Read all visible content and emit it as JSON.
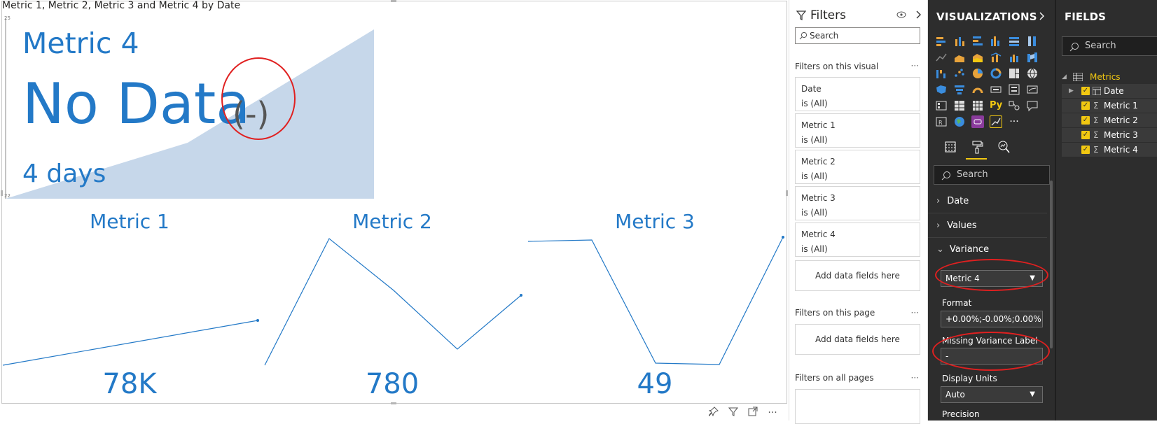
{
  "visual": {
    "title": "Metric 1, Metric 2, Metric 3 and Metric 4 by Date",
    "axis_top": "25",
    "axis_bottom": "22",
    "kpi_label": "Metric 4",
    "kpi_value": "No Data",
    "kpi_variance": "(-)",
    "kpi_days": "4 days",
    "metric1_title": "Metric 1",
    "metric1_value": "78K",
    "metric2_title": "Metric 2",
    "metric2_value": "780",
    "metric3_title": "Metric 3",
    "metric3_value": "49"
  },
  "canvas_toolbar": {
    "pin_icon": "pin-icon",
    "filter_icon": "filter-icon",
    "focus_icon": "focus-mode-icon",
    "more_icon": "more-options-icon",
    "more_text": "···"
  },
  "filters": {
    "title": "Filters",
    "search_placeholder": "Search",
    "on_visual_label": "Filters on this visual",
    "cards": [
      {
        "name": "Date",
        "value": "is (All)"
      },
      {
        "name": "Metric 1",
        "value": "is (All)"
      },
      {
        "name": "Metric 2",
        "value": "is (All)"
      },
      {
        "name": "Metric 3",
        "value": "is (All)"
      },
      {
        "name": "Metric 4",
        "value": "is (All)"
      }
    ],
    "add_fields": "Add data fields here",
    "on_page_label": "Filters on this page",
    "add_fields_page": "Add data fields here",
    "on_all_pages_label": "Filters on all pages",
    "more_text": "···"
  },
  "visualizations": {
    "title": "VISUALIZATIONS",
    "search_placeholder": "Search",
    "py_label": "Py",
    "more_label": "···",
    "sections": {
      "date": "Date",
      "values": "Values",
      "variance": "Variance"
    },
    "variance_dropdown": "Metric 4",
    "format_label": "Format",
    "format_value": "+0.00%;-0.00%;0.00%",
    "missing_label": "Missing Variance Label",
    "missing_value": "-",
    "display_units_label": "Display Units",
    "display_units_value": "Auto",
    "precision_label": "Precision"
  },
  "fields": {
    "title": "FIELDS",
    "search_placeholder": "Search",
    "table_name": "Metrics",
    "items": [
      "Date",
      "Metric 1",
      "Metric 2",
      "Metric 3",
      "Metric 4"
    ]
  },
  "colors": {
    "accent_blue": "#2379c7",
    "area_fill": "#c6d7ea",
    "pane_dark": "#2d2d2d",
    "checkbox_yellow": "#f2c811",
    "annotation_red": "#e02020"
  }
}
